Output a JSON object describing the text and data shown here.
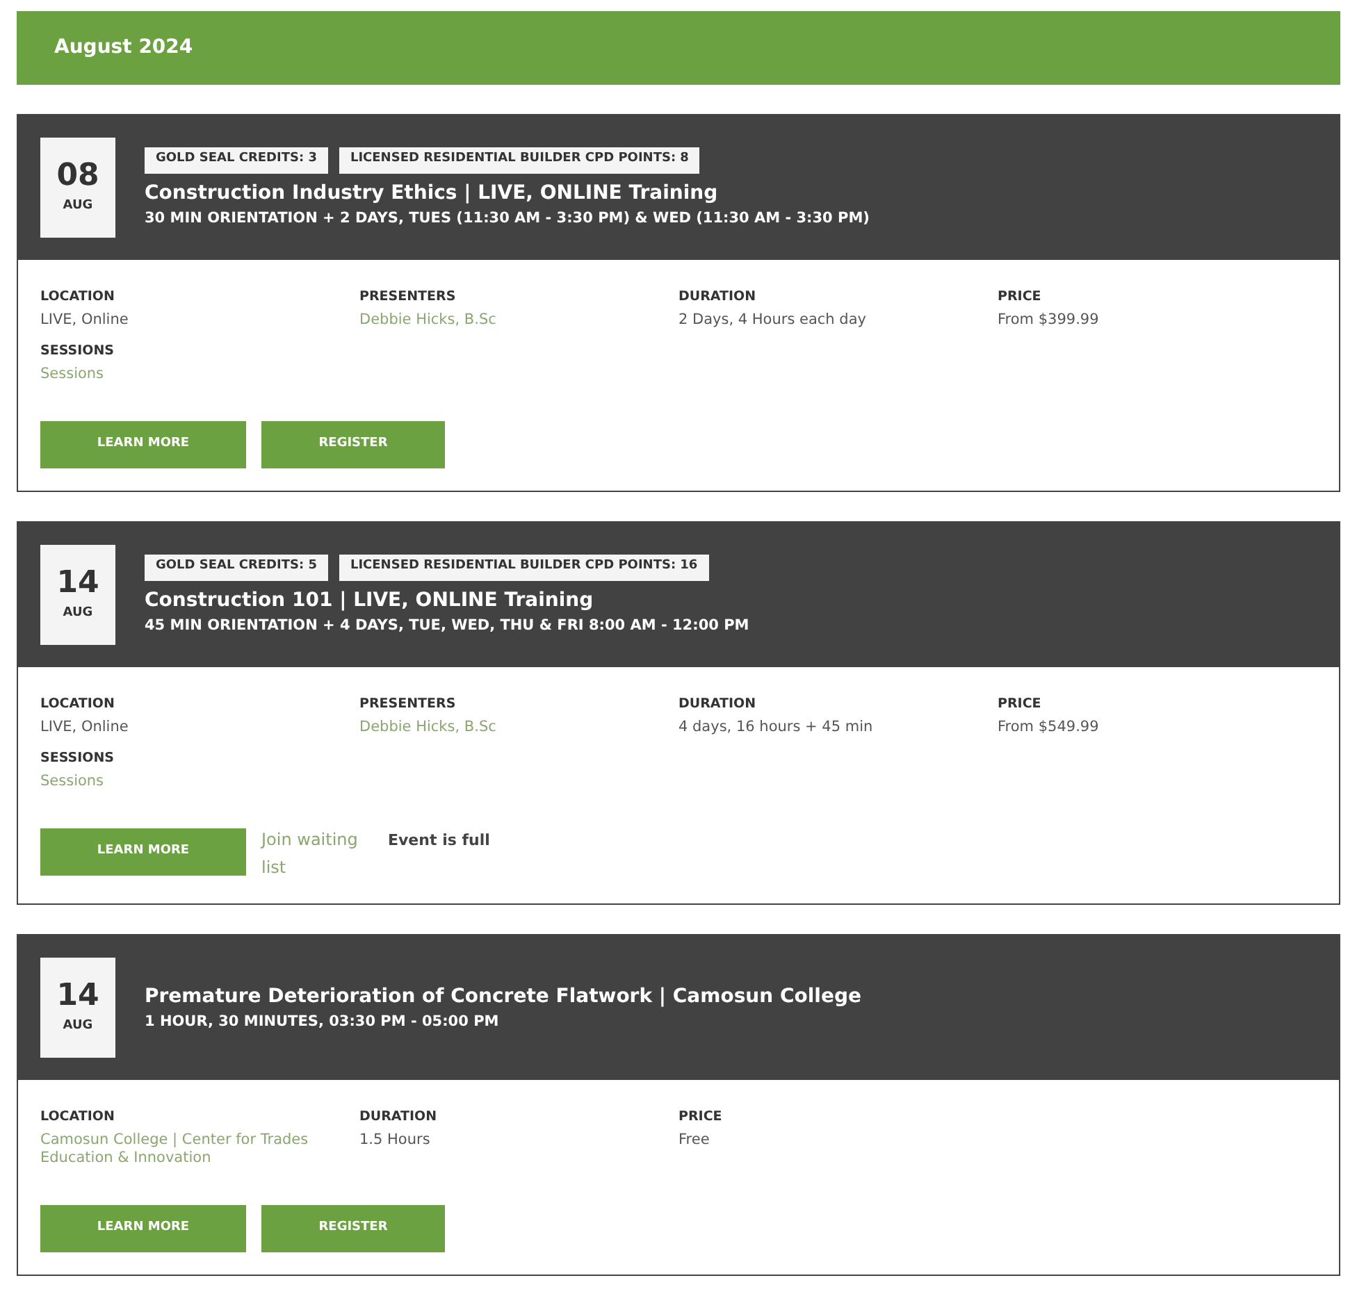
{
  "month_header": {
    "title": "August 2024"
  },
  "events": [
    {
      "date": {
        "day": "08",
        "month": "AUG"
      },
      "badges": [
        "GOLD SEAL CREDITS: 3",
        "LICENSED RESIDENTIAL BUILDER CPD POINTS: 8"
      ],
      "title": "Construction Industry Ethics | LIVE, ONLINE Training",
      "schedule": "30 MIN ORIENTATION + 2 DAYS, TUES (11:30 AM - 3:30 PM) & WED (11:30 AM - 3:30 PM)",
      "columns": [
        [
          {
            "label": "LOCATION",
            "value": "LIVE, Online",
            "kind": "plain"
          },
          {
            "label": "SESSIONS",
            "value": "Sessions",
            "kind": "link"
          }
        ],
        [
          {
            "label": "PRESENTERS",
            "value": "Debbie Hicks, B.Sc",
            "kind": "link"
          }
        ],
        [
          {
            "label": "DURATION",
            "value": "2 Days, 4 Hours each day",
            "kind": "plain"
          }
        ],
        [
          {
            "label": "PRICE",
            "value": "From $399.99",
            "kind": "plain"
          }
        ]
      ],
      "actions": [
        {
          "kind": "button",
          "label": "LEARN MORE"
        },
        {
          "kind": "button",
          "label": "REGISTER"
        }
      ]
    },
    {
      "date": {
        "day": "14",
        "month": "AUG"
      },
      "badges": [
        "GOLD SEAL CREDITS: 5",
        "LICENSED RESIDENTIAL BUILDER CPD POINTS: 16"
      ],
      "title": "Construction 101 | LIVE, ONLINE Training",
      "schedule": "45 MIN ORIENTATION + 4 DAYS, TUE, WED, THU & FRI 8:00 AM - 12:00 PM",
      "columns": [
        [
          {
            "label": "LOCATION",
            "value": "LIVE, Online",
            "kind": "plain"
          },
          {
            "label": "SESSIONS",
            "value": "Sessions",
            "kind": "link"
          }
        ],
        [
          {
            "label": "PRESENTERS",
            "value": "Debbie Hicks, B.Sc",
            "kind": "link"
          }
        ],
        [
          {
            "label": "DURATION",
            "value": "4 days, 16 hours + 45 min",
            "kind": "plain"
          }
        ],
        [
          {
            "label": "PRICE",
            "value": "From $549.99",
            "kind": "plain"
          }
        ]
      ],
      "actions": [
        {
          "kind": "button",
          "label": "LEARN MORE"
        },
        {
          "kind": "link",
          "label": "Join waiting list"
        },
        {
          "kind": "note",
          "label": "Event is full"
        }
      ]
    },
    {
      "date": {
        "day": "14",
        "month": "AUG"
      },
      "title": "Premature Deterioration of Concrete Flatwork | Camosun College",
      "schedule": "1 HOUR, 30 MINUTES, 03:30 PM - 05:00 PM",
      "columns": [
        [
          {
            "label": "LOCATION",
            "value": "Camosun College | Center for Trades Education & Innovation",
            "kind": "link"
          }
        ],
        [
          {
            "label": "DURATION",
            "value": "1.5 Hours",
            "kind": "plain"
          }
        ],
        [
          {
            "label": "PRICE",
            "value": "Free",
            "kind": "plain"
          }
        ]
      ],
      "actions": [
        {
          "kind": "button",
          "label": "LEARN MORE"
        },
        {
          "kind": "button",
          "label": "REGISTER"
        }
      ]
    }
  ]
}
